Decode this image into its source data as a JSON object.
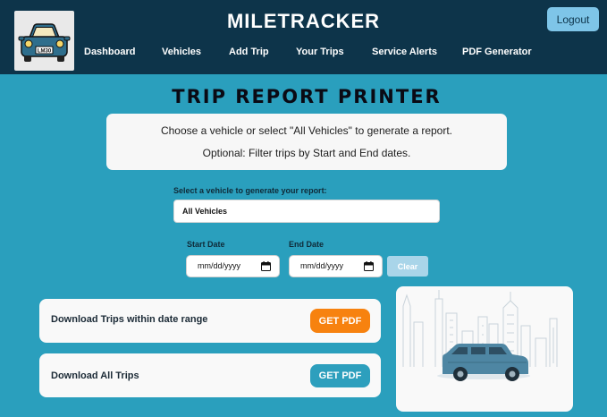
{
  "app": {
    "title": "MILETRACKER",
    "logo_plate": "LM30"
  },
  "nav": {
    "items": [
      {
        "label": "Dashboard"
      },
      {
        "label": "Vehicles"
      },
      {
        "label": "Add Trip"
      },
      {
        "label": "Your Trips"
      },
      {
        "label": "Service Alerts"
      },
      {
        "label": "PDF Generator"
      }
    ],
    "logout_label": "Logout"
  },
  "page": {
    "title": "TRIP REPORT PRINTER",
    "info_line1": "Choose a vehicle or select \"All Vehicles\" to generate a report.",
    "info_line2": "Optional: Filter trips by Start and End dates."
  },
  "form": {
    "vehicle_label": "Select a vehicle to generate your report:",
    "vehicle_value": "All Vehicles",
    "start_label": "Start Date",
    "end_label": "End Date",
    "start_value": "mm/dd/yyyy",
    "end_value": "mm/dd/yyyy",
    "clear_label": "Clear"
  },
  "downloads": {
    "range": {
      "text": "Download Trips within date range",
      "button": "GET PDF",
      "color": "#f7820f"
    },
    "all": {
      "text": "Download All Trips",
      "button": "GET PDF",
      "color": "#2d9fbd"
    }
  },
  "colors": {
    "header_bg": "#0d344a",
    "page_bg": "#2a9fbd",
    "logout_bg": "#7ec5e8",
    "clear_bg": "#a9d5e9",
    "illustration_car": "#4e86a3"
  },
  "illustration": {
    "icon": "car-city-illustration"
  }
}
